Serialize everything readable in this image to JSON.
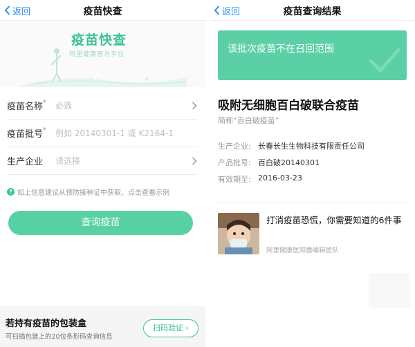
{
  "left": {
    "nav": {
      "back_label": "返回",
      "title": "疫苗快查"
    },
    "hero": {
      "brand": "疫苗快查",
      "subtitle": "阿里健康官方平台"
    },
    "form": {
      "name": {
        "label": "疫苗名称",
        "required_mark": "*",
        "placeholder": "必选"
      },
      "batch": {
        "label": "疫苗批号",
        "required_mark": "*",
        "placeholder": "例如 20140301-1 或 K2164-1"
      },
      "company": {
        "label": "生产企业",
        "placeholder": "请选择"
      }
    },
    "hint": {
      "icon": "?",
      "text": "如上信息建议从预防接种证中获取，点击查看示例"
    },
    "query_button": "查询疫苗",
    "bottom_card": {
      "title": "若持有疫苗的包装盒",
      "subtitle": "可扫描包装上的20位条形码查询信息",
      "scan_button": "扫码验证"
    }
  },
  "right": {
    "nav": {
      "back_label": "返回",
      "title": "疫苗查询结果"
    },
    "result_banner": "该批次疫苗不在召回范围",
    "vaccine_name": "吸附无细胞百白破联合疫苗",
    "vaccine_alias": "简称“百白破疫苗”",
    "info": [
      {
        "label": "生产企业:",
        "value": "长春长生生物科技有限责任公司"
      },
      {
        "label": "产品批号:",
        "value": "百白破20140301"
      },
      {
        "label": "有效期至:",
        "value": "2016-03-23"
      }
    ],
    "article": {
      "title": "打消疫苗恐慌，你需要知道的6件事",
      "source": "阿里健康医知鹿编辑团队"
    }
  },
  "colors": {
    "accent": "#3cc396",
    "button": "#58d1a4",
    "banner": "#5bcfa5",
    "link": "#2f8ff0"
  }
}
